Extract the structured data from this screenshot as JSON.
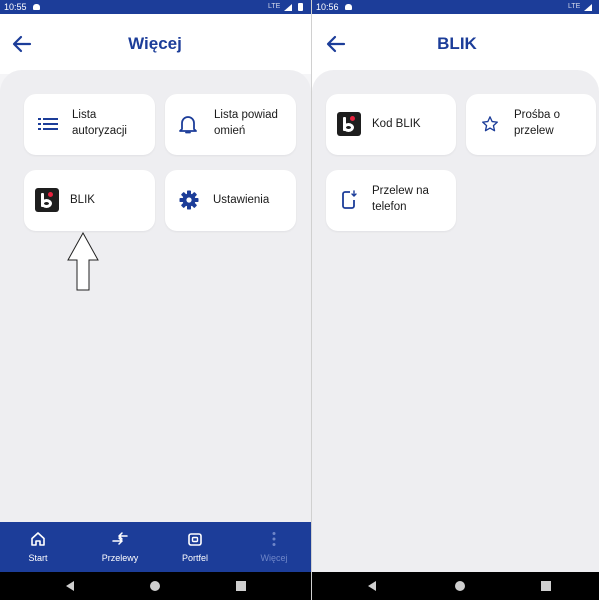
{
  "left_screen": {
    "status": {
      "time": "10:55",
      "network": "LTE"
    },
    "header": {
      "title": "Więcej",
      "back_icon": "arrow-left-icon"
    },
    "tiles": [
      {
        "label_line1": "Lista",
        "label_line2": "autoryzacji",
        "icon": "list-icon"
      },
      {
        "label_line1": "Lista powiad",
        "label_line2": "omień",
        "icon": "bell-icon"
      },
      {
        "label_line1": "BLIK",
        "label_line2": "",
        "icon": "blik-logo-icon"
      },
      {
        "label_line1": "Ustawienia",
        "label_line2": "",
        "icon": "gear-icon"
      }
    ],
    "bottom_nav": [
      {
        "label": "Start",
        "icon": "home-icon",
        "active": true
      },
      {
        "label": "Przelewy",
        "icon": "transfer-icon",
        "active": true
      },
      {
        "label": "Portfel",
        "icon": "wallet-icon",
        "active": true
      },
      {
        "label": "Więcej",
        "icon": "more-vertical-icon",
        "active": false
      }
    ],
    "annotation": "up-arrow-outline"
  },
  "right_screen": {
    "status": {
      "time": "10:56",
      "network": "LTE"
    },
    "header": {
      "title": "BLIK",
      "back_icon": "arrow-left-icon"
    },
    "tiles": [
      {
        "label_line1": "Kod BLIK",
        "label_line2": "",
        "icon": "blik-logo-icon"
      },
      {
        "label_line1": "Prośba o",
        "label_line2": "przelew",
        "icon": "star-icon"
      },
      {
        "label_line1": "Przelew na",
        "label_line2": "telefon",
        "icon": "phone-transfer-icon"
      }
    ]
  },
  "colors": {
    "brand": "#1c3d99",
    "background": "#eeeef1",
    "card": "#ffffff",
    "blik_red": "#e8223e"
  }
}
